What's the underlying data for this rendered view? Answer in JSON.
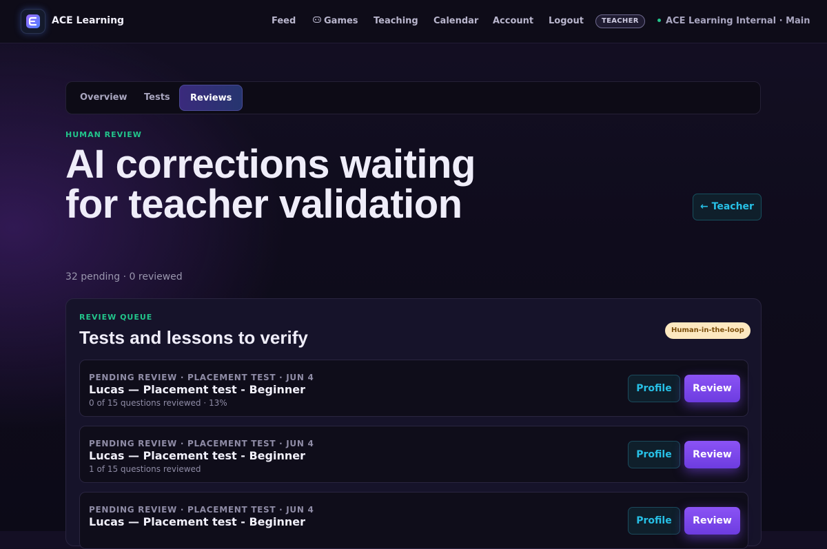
{
  "app": {
    "brand_name": "ACE Learning",
    "nav": {
      "feed": "Feed",
      "games": "Games",
      "teaching": "Teaching",
      "calendar": "Calendar",
      "account": "Account",
      "logout": "Logout"
    },
    "role_badge": "TEACHER",
    "environment": "ACE Learning Internal · Main"
  },
  "tabs": [
    {
      "label": "Overview",
      "active": false
    },
    {
      "label": "Tests",
      "active": false
    },
    {
      "label": "Reviews",
      "active": true
    }
  ],
  "hero": {
    "eyebrow": "HUMAN REVIEW",
    "title": "AI corrections waiting for teacher validation",
    "subtitle": "32 pending · 0 reviewed",
    "back_button": "← Teacher"
  },
  "queue": {
    "eyebrow": "REVIEW QUEUE",
    "title": "Tests and lessons to verify",
    "badge": "Human-in-the-loop",
    "items": [
      {
        "meta": "PENDING REVIEW · PLACEMENT TEST · JUN 4",
        "title": "Lucas — Placement test - Beginner",
        "progress": "0 of 15 questions reviewed · 13%",
        "profile_label": "Profile",
        "review_label": "Review"
      },
      {
        "meta": "PENDING REVIEW · PLACEMENT TEST · JUN 4",
        "title": "Lucas — Placement test - Beginner",
        "progress": "1 of 15 questions reviewed",
        "profile_label": "Profile",
        "review_label": "Review"
      },
      {
        "meta": "PENDING REVIEW · PLACEMENT TEST · JUN 4",
        "title": "Lucas — Placement test - Beginner",
        "progress": "",
        "profile_label": "Profile",
        "review_label": "Review"
      }
    ]
  },
  "colors": {
    "accent_green": "#22c58b",
    "accent_cyan": "#27c0e6",
    "accent_purple": "#7c4af0",
    "badge_amber": "#fde8c0"
  },
  "icons": {
    "logo": "ace-logo-icon",
    "games": "gamepad-icon",
    "status": "status-dot-icon"
  }
}
